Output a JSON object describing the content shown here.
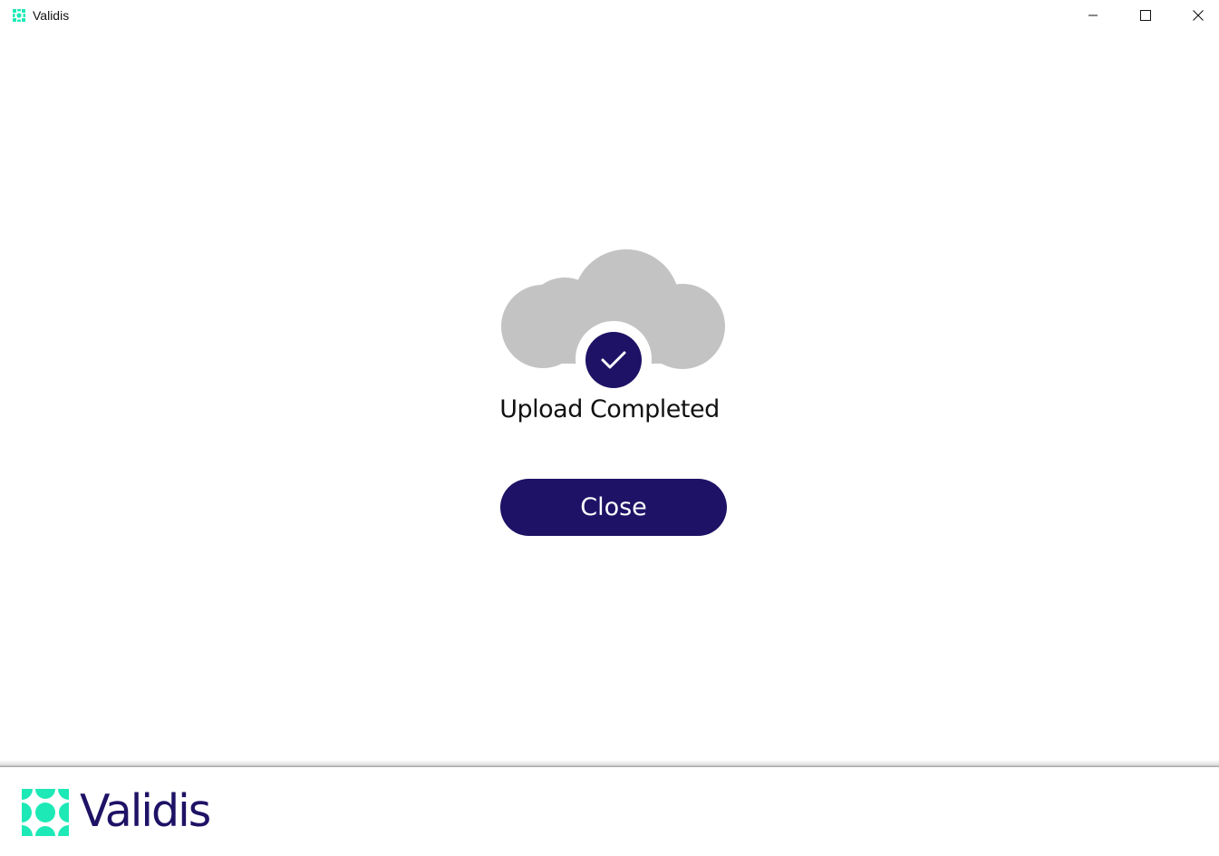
{
  "window": {
    "title": "Validis",
    "controls": [
      "minimize",
      "maximize",
      "close"
    ]
  },
  "upload": {
    "status_text": "Upload Completed",
    "icon": "cloud-check-icon"
  },
  "actions": {
    "close_label": "Close"
  },
  "footer": {
    "logo_text": "Validis"
  },
  "colors": {
    "brand_navy": "#1e1266",
    "brand_mint": "#1de9b6",
    "cloud_grey": "#c3c3c3"
  }
}
